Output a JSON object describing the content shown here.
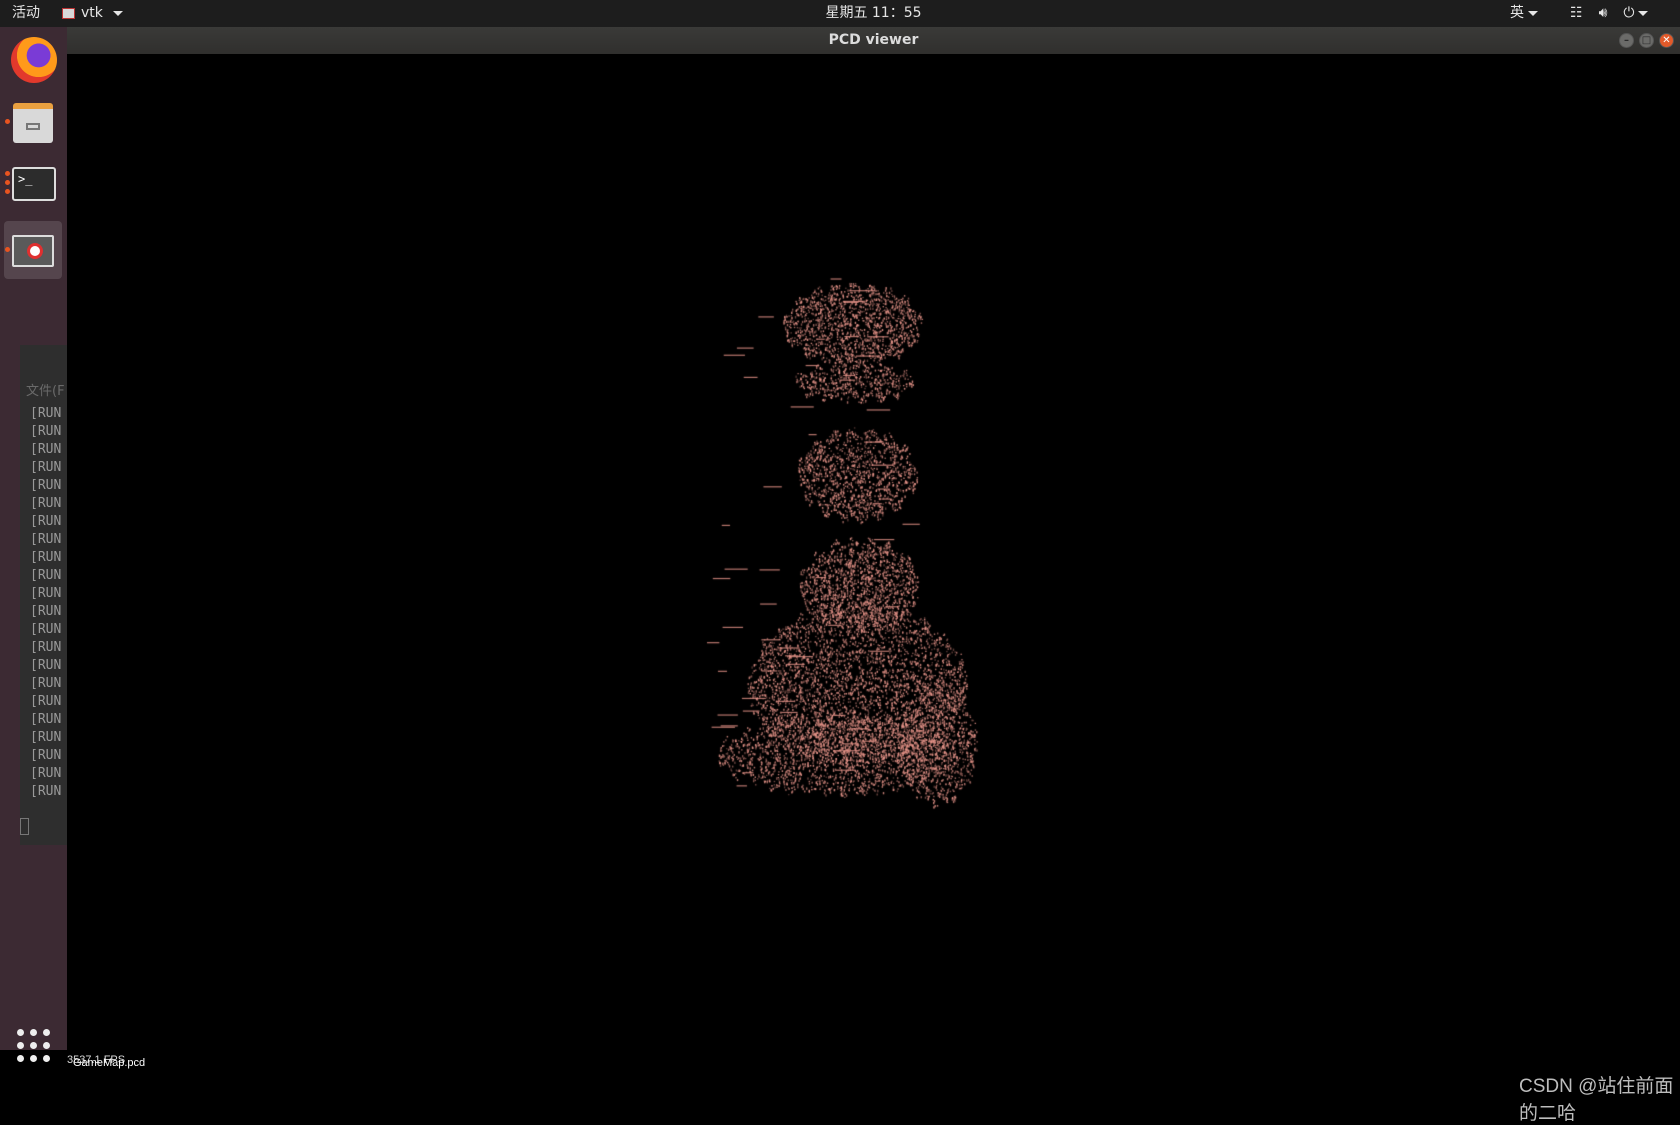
{
  "topbar": {
    "activities": "活动",
    "app_menu": "vtk",
    "clock": "星期五 11：55",
    "language": "英"
  },
  "dock": {
    "apps": [
      "firefox",
      "files",
      "terminal",
      "vtk-viewer"
    ]
  },
  "bg_terminal": {
    "menu_text": "文件(F",
    "line_prefix": "[RUN",
    "line_count": 22
  },
  "window": {
    "title": "PCD viewer"
  },
  "viewer": {
    "fps_text": "3537.1 FPS",
    "filename": "GameMap.pcd",
    "point_color": "#e8958a",
    "background": "#000000"
  },
  "watermark": "CSDN @站住前面的二哈",
  "colors": {
    "topbar": "#1d1d1d",
    "dock": "#3c2a33",
    "accent": "#e95420"
  }
}
